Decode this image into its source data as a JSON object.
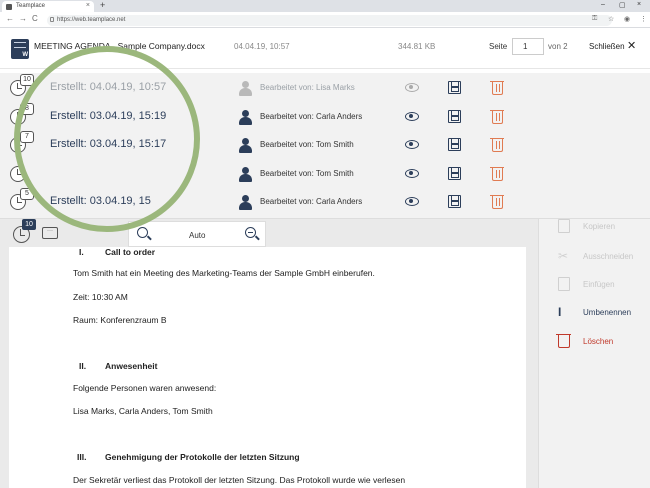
{
  "browser": {
    "tab_title": "Teamplace",
    "tab_close": "×",
    "new_tab": "+",
    "url": "https://web.teamplace.net",
    "controls": [
      "–",
      "▢",
      "×"
    ],
    "nav": [
      "←",
      "→",
      "C"
    ],
    "bar_icons": [
      "⚿",
      "☆",
      "◉",
      "⋮"
    ]
  },
  "header": {
    "doc_title": "MEETING AGENDA - Sample Company.docx",
    "date": "04.04.19, 10:57",
    "size": "344.81 KB",
    "page_label": "Seite",
    "page_value": "1",
    "page_of": "von 2",
    "close_label": "Schließen",
    "close_icon": "✕",
    "doc_icon_letter": "W"
  },
  "versions": [
    {
      "badge": "10",
      "created": "Erstellt:  04.04.19, 10:57",
      "editor": "Bearbeitet von:  Lisa Marks",
      "current": true
    },
    {
      "badge": "8",
      "created": "Erstellt:  03.04.19, 15:19",
      "editor": "Bearbeitet von:  Carla Anders",
      "current": false
    },
    {
      "badge": "7",
      "created": "Erstellt:  03.04.19, 15:17",
      "editor": "Bearbeitet von:  Tom Smith",
      "current": false
    },
    {
      "badge": "",
      "created": "",
      "editor": "Bearbeitet von:  Tom Smith",
      "current": false
    },
    {
      "badge": "5",
      "created": "Erstellt:  03.04.19, 15",
      "editor": "Bearbeitet von:  Carla Anders",
      "current": false
    }
  ],
  "toolbar": {
    "badge": "10",
    "chat_glyph": "···",
    "zoom_label": "Auto"
  },
  "document": {
    "s1_num": "I.",
    "s1_title": "Call to order",
    "s1_p1": "Tom Smith hat ein Meeting des Marketing-Teams der Sample GmbH einberufen.",
    "s1_p2": "Zeit: 10:30 AM",
    "s1_p3": "Raum: Konferenzraum B",
    "s2_num": "II.",
    "s2_title": "Anwesenheit",
    "s2_p1": "Folgende Personen waren anwesend:",
    "s2_p2": "Lisa Marks, Carla Anders, Tom Smith",
    "s3_num": "III.",
    "s3_title": "Genehmigung der Protokolle der letzten Sitzung",
    "s3_p1": "Der Sekretär verliest das Protokoll der letzten Sitzung. Das Protokoll wurde wie verlesen"
  },
  "sidebar": {
    "items": [
      {
        "label": "Kopieren",
        "icon": "copy-icon",
        "enabled": false
      },
      {
        "label": "Ausschneiden",
        "icon": "cut-icon",
        "enabled": false
      },
      {
        "label": "Einfügen",
        "icon": "paste-icon",
        "enabled": false
      },
      {
        "label": "Umbenennen",
        "icon": "rename-icon",
        "enabled": true
      },
      {
        "label": "Löschen",
        "icon": "delete-icon",
        "enabled": true
      }
    ],
    "cut_glyph": "✂",
    "rename_glyph": "I"
  },
  "colors": {
    "primary": "#2c3e5a",
    "delete": "#c0392b",
    "trash_version": "#e07b52",
    "lens": "#9bb77c"
  }
}
